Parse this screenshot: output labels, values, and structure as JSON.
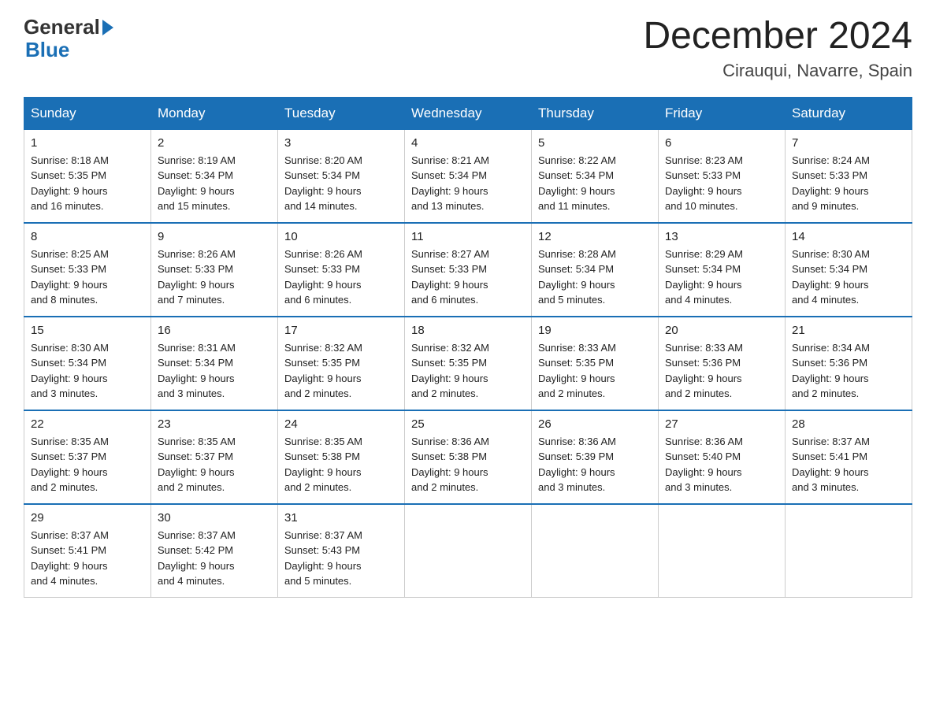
{
  "logo": {
    "text_general": "General",
    "text_blue": "Blue",
    "arrow": true
  },
  "title": "December 2024",
  "subtitle": "Cirauqui, Navarre, Spain",
  "days_of_week": [
    "Sunday",
    "Monday",
    "Tuesday",
    "Wednesday",
    "Thursday",
    "Friday",
    "Saturday"
  ],
  "weeks": [
    [
      {
        "day": "1",
        "sunrise": "8:18 AM",
        "sunset": "5:35 PM",
        "daylight": "9 hours and 16 minutes."
      },
      {
        "day": "2",
        "sunrise": "8:19 AM",
        "sunset": "5:34 PM",
        "daylight": "9 hours and 15 minutes."
      },
      {
        "day": "3",
        "sunrise": "8:20 AM",
        "sunset": "5:34 PM",
        "daylight": "9 hours and 14 minutes."
      },
      {
        "day": "4",
        "sunrise": "8:21 AM",
        "sunset": "5:34 PM",
        "daylight": "9 hours and 13 minutes."
      },
      {
        "day": "5",
        "sunrise": "8:22 AM",
        "sunset": "5:34 PM",
        "daylight": "9 hours and 11 minutes."
      },
      {
        "day": "6",
        "sunrise": "8:23 AM",
        "sunset": "5:33 PM",
        "daylight": "9 hours and 10 minutes."
      },
      {
        "day": "7",
        "sunrise": "8:24 AM",
        "sunset": "5:33 PM",
        "daylight": "9 hours and 9 minutes."
      }
    ],
    [
      {
        "day": "8",
        "sunrise": "8:25 AM",
        "sunset": "5:33 PM",
        "daylight": "9 hours and 8 minutes."
      },
      {
        "day": "9",
        "sunrise": "8:26 AM",
        "sunset": "5:33 PM",
        "daylight": "9 hours and 7 minutes."
      },
      {
        "day": "10",
        "sunrise": "8:26 AM",
        "sunset": "5:33 PM",
        "daylight": "9 hours and 6 minutes."
      },
      {
        "day": "11",
        "sunrise": "8:27 AM",
        "sunset": "5:33 PM",
        "daylight": "9 hours and 6 minutes."
      },
      {
        "day": "12",
        "sunrise": "8:28 AM",
        "sunset": "5:34 PM",
        "daylight": "9 hours and 5 minutes."
      },
      {
        "day": "13",
        "sunrise": "8:29 AM",
        "sunset": "5:34 PM",
        "daylight": "9 hours and 4 minutes."
      },
      {
        "day": "14",
        "sunrise": "8:30 AM",
        "sunset": "5:34 PM",
        "daylight": "9 hours and 4 minutes."
      }
    ],
    [
      {
        "day": "15",
        "sunrise": "8:30 AM",
        "sunset": "5:34 PM",
        "daylight": "9 hours and 3 minutes."
      },
      {
        "day": "16",
        "sunrise": "8:31 AM",
        "sunset": "5:34 PM",
        "daylight": "9 hours and 3 minutes."
      },
      {
        "day": "17",
        "sunrise": "8:32 AM",
        "sunset": "5:35 PM",
        "daylight": "9 hours and 2 minutes."
      },
      {
        "day": "18",
        "sunrise": "8:32 AM",
        "sunset": "5:35 PM",
        "daylight": "9 hours and 2 minutes."
      },
      {
        "day": "19",
        "sunrise": "8:33 AM",
        "sunset": "5:35 PM",
        "daylight": "9 hours and 2 minutes."
      },
      {
        "day": "20",
        "sunrise": "8:33 AM",
        "sunset": "5:36 PM",
        "daylight": "9 hours and 2 minutes."
      },
      {
        "day": "21",
        "sunrise": "8:34 AM",
        "sunset": "5:36 PM",
        "daylight": "9 hours and 2 minutes."
      }
    ],
    [
      {
        "day": "22",
        "sunrise": "8:35 AM",
        "sunset": "5:37 PM",
        "daylight": "9 hours and 2 minutes."
      },
      {
        "day": "23",
        "sunrise": "8:35 AM",
        "sunset": "5:37 PM",
        "daylight": "9 hours and 2 minutes."
      },
      {
        "day": "24",
        "sunrise": "8:35 AM",
        "sunset": "5:38 PM",
        "daylight": "9 hours and 2 minutes."
      },
      {
        "day": "25",
        "sunrise": "8:36 AM",
        "sunset": "5:38 PM",
        "daylight": "9 hours and 2 minutes."
      },
      {
        "day": "26",
        "sunrise": "8:36 AM",
        "sunset": "5:39 PM",
        "daylight": "9 hours and 3 minutes."
      },
      {
        "day": "27",
        "sunrise": "8:36 AM",
        "sunset": "5:40 PM",
        "daylight": "9 hours and 3 minutes."
      },
      {
        "day": "28",
        "sunrise": "8:37 AM",
        "sunset": "5:41 PM",
        "daylight": "9 hours and 3 minutes."
      }
    ],
    [
      {
        "day": "29",
        "sunrise": "8:37 AM",
        "sunset": "5:41 PM",
        "daylight": "9 hours and 4 minutes."
      },
      {
        "day": "30",
        "sunrise": "8:37 AM",
        "sunset": "5:42 PM",
        "daylight": "9 hours and 4 minutes."
      },
      {
        "day": "31",
        "sunrise": "8:37 AM",
        "sunset": "5:43 PM",
        "daylight": "9 hours and 5 minutes."
      },
      null,
      null,
      null,
      null
    ]
  ],
  "labels": {
    "sunrise": "Sunrise:",
    "sunset": "Sunset:",
    "daylight": "Daylight:"
  }
}
